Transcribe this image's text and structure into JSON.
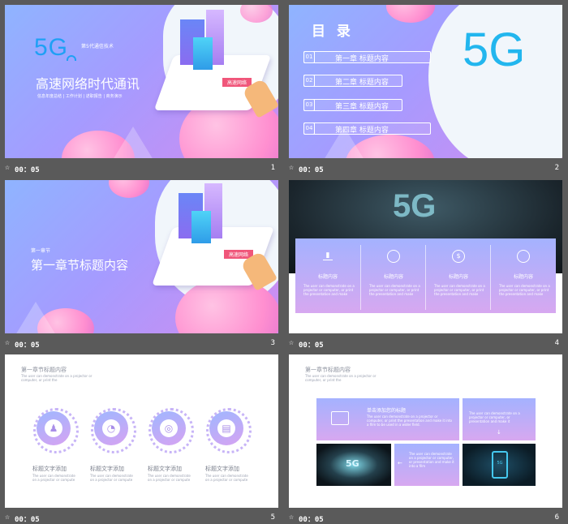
{
  "slides": [
    {
      "num": "1",
      "time": "00：05",
      "logo": "5G",
      "tagline": "第5代通信技术",
      "title": "高速网络时代通讯",
      "subtitle": "信息年度总结 | 工作计划 | 述职报告 | 商务演示",
      "phone_banner": "高速网络"
    },
    {
      "num": "2",
      "time": "00：05",
      "heading": "目 录",
      "logo": "5G",
      "items": [
        {
          "n": "01",
          "label": "第一章  标题内容"
        },
        {
          "n": "02",
          "label": "第二章  标题内容"
        },
        {
          "n": "03",
          "label": "第三章  标题内容"
        },
        {
          "n": "04",
          "label": "第四章  标题内容"
        }
      ]
    },
    {
      "num": "3",
      "time": "00：05",
      "kicker": "第一章节",
      "title": "第一章节标题内容",
      "phone_banner": "高速网络"
    },
    {
      "num": "4",
      "time": "00：05",
      "hero": "5G",
      "cards": [
        {
          "label": "标题内容",
          "text": "The user can demonstrate on a projector or computer, or print the presentation and make"
        },
        {
          "label": "标题内容",
          "text": "The user can demonstrate on a projector or computer, or print the presentation and make"
        },
        {
          "label": "标题内容",
          "text": "The user can demonstrate on a projector or computer, or print the presentation and make"
        },
        {
          "label": "标题内容",
          "text": "The user can demonstrate on a projector or computer, or print the presentation and make"
        }
      ]
    },
    {
      "num": "5",
      "time": "00：05",
      "title": "第一章节标题内容",
      "desc": "The user can demonstrate on a projector or computer, or print the",
      "items": [
        {
          "label": "标题文字添加",
          "text": "The user can demonstrate on a projector or compute"
        },
        {
          "label": "标题文字添加",
          "text": "The user can demonstrate on a projector or compute"
        },
        {
          "label": "标题文字添加",
          "text": "The user can demonstrate on a projector or compute"
        },
        {
          "label": "标题文字添加",
          "text": "The user can demonstrate on a projector or compute"
        }
      ]
    },
    {
      "num": "6",
      "time": "00：05",
      "title": "第一章节标题内容",
      "desc": "The user can demonstrate on a projector or computer, or print the",
      "box1_title": "单击添加您的标题",
      "box1_text": "The user can demonstrate on a projector or computer, or print the presentation and make it into a film to be used in a wider field.",
      "box2_text": "The user can demonstrate on a projector or computer, or presentation and make it",
      "box3_text": "The user can demonstrate on a projector or computer, or presentation and make it into a film",
      "img1_label": "5G",
      "img2_label": "5G"
    }
  ],
  "colors": {
    "bg": "#5a5a5a",
    "accent_blue": "#1e9bf0",
    "purple": "#a59bff",
    "pink": "#ff8fd0"
  }
}
